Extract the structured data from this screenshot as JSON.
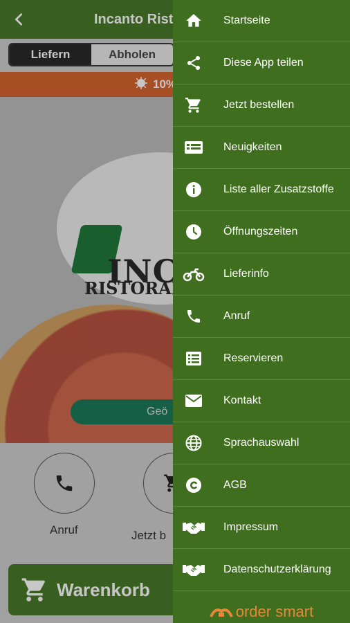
{
  "app": {
    "title": "Incanto Risto",
    "tabs": {
      "deliver": "Liefern",
      "pickup": "Abholen"
    },
    "promo_text": "10%",
    "hero": {
      "logo_line1": "INCA",
      "logo_line2": "RISTORANT",
      "pill_text": "Geö"
    },
    "actions": [
      {
        "label": "Anruf",
        "icon": "phone-icon"
      },
      {
        "label": "Jetzt b",
        "icon": "cart-icon"
      }
    ],
    "cart_label": "Warenkorb"
  },
  "drawer": {
    "items": [
      {
        "label": "Startseite",
        "icon": "home-icon"
      },
      {
        "label": "Diese App teilen",
        "icon": "share-icon"
      },
      {
        "label": "Jetzt bestellen",
        "icon": "cart-icon"
      },
      {
        "label": "Neuigkeiten",
        "icon": "news-icon"
      },
      {
        "label": "Liste aller Zusatzstoffe",
        "icon": "info-icon"
      },
      {
        "label": "Öffnungszeiten",
        "icon": "clock-icon"
      },
      {
        "label": "Lieferinfo",
        "icon": "motorbike-icon"
      },
      {
        "label": "Anruf",
        "icon": "phone-icon"
      },
      {
        "label": "Reservieren",
        "icon": "list-icon"
      },
      {
        "label": "Kontakt",
        "icon": "mail-icon"
      },
      {
        "label": "Sprachauswahl",
        "icon": "globe-icon"
      },
      {
        "label": "AGB",
        "icon": "copyright-icon"
      },
      {
        "label": "Impressum",
        "icon": "handshake-icon"
      },
      {
        "label": "Datenschutzerklärung",
        "icon": "handshake-icon"
      }
    ],
    "brand": "order smart"
  },
  "colors": {
    "primary_green": "#4a7a2a",
    "drawer_green": "#3f6f1e",
    "promo_orange": "#d7642f",
    "brand_orange": "#e8863a"
  }
}
